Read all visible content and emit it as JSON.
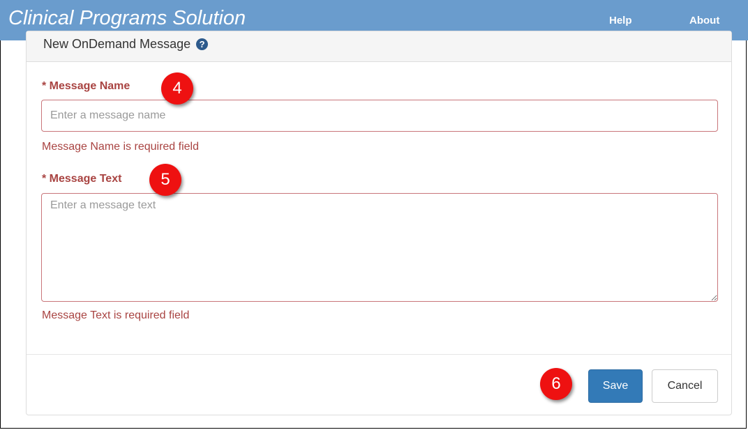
{
  "header": {
    "brand": "Clinical Programs Solution",
    "nav": {
      "help": "Help",
      "about": "About"
    }
  },
  "panel": {
    "title": "New OnDemand Message",
    "help_icon": "question-circle-icon"
  },
  "form": {
    "message_name": {
      "label": "* Message Name",
      "placeholder": "Enter a message name",
      "value": "",
      "error": "Message Name is required field"
    },
    "message_text": {
      "label": "* Message Text",
      "placeholder": "Enter a message text",
      "value": "",
      "error": "Message Text is required field"
    }
  },
  "actions": {
    "save_label": "Save",
    "cancel_label": "Cancel"
  },
  "callouts": {
    "name": "4",
    "text": "5",
    "save": "6"
  },
  "colors": {
    "header_bg": "#6a9ccd",
    "error": "#a94442",
    "primary": "#337ab7",
    "callout": "#ee1111"
  }
}
